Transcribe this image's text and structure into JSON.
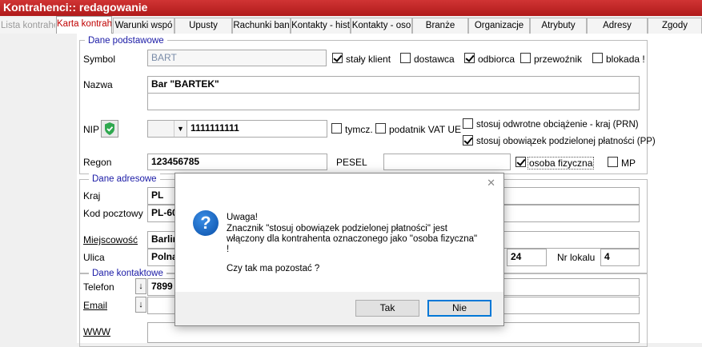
{
  "window": {
    "title": "Kontrahenci:: redagowanie"
  },
  "tabs": [
    {
      "label": "Lista kontrahe",
      "state": "disabled"
    },
    {
      "label": "Karta kontrahe",
      "state": "active"
    },
    {
      "label": "Warunki wspó",
      "state": "normal"
    },
    {
      "label": "Upusty",
      "state": "normal"
    },
    {
      "label": "Rachunki ban",
      "state": "normal"
    },
    {
      "label": "Kontakty - hist",
      "state": "normal"
    },
    {
      "label": "Kontakty - oso",
      "state": "normal"
    },
    {
      "label": "Branże",
      "state": "normal"
    },
    {
      "label": "Organizacje",
      "state": "normal"
    },
    {
      "label": "Atrybuty",
      "state": "normal"
    },
    {
      "label": "Adresy",
      "state": "normal"
    },
    {
      "label": "Zgody",
      "state": "normal"
    }
  ],
  "basic": {
    "group_title": "Dane podstawowe",
    "symbol_label": "Symbol",
    "symbol_value": "BART",
    "name_label": "Nazwa",
    "name_value": "Bar \"BARTEK\"",
    "name_value2": "",
    "nip_label": "NIP",
    "nip_value": "1111111111",
    "regon_label": "Regon",
    "regon_value": "123456785",
    "pesel_label": "PESEL",
    "pesel_value": "",
    "checkboxes": {
      "staly_klient": {
        "label": "stały klient",
        "checked": true
      },
      "dostawca": {
        "label": "dostawca",
        "checked": false
      },
      "odbiorca": {
        "label": "odbiorca",
        "checked": true
      },
      "przewoznik": {
        "label": "przewoźnik",
        "checked": false
      },
      "blokada": {
        "label": "blokada !",
        "checked": false
      },
      "tymcz": {
        "label": "tymcz.",
        "checked": false
      },
      "podatnik_vat_ue": {
        "label": "podatnik VAT UE",
        "checked": false
      },
      "prn": {
        "label": "stosuj odwrotne obciążenie - kraj (PRN)",
        "checked": false
      },
      "pp": {
        "label": "stosuj obowiązek podzielonej płatności (PP)",
        "checked": true
      },
      "osoba_fizyczna": {
        "label": "osoba fizyczna",
        "checked": true
      },
      "mp": {
        "label": "MP",
        "checked": false
      }
    }
  },
  "address": {
    "group_title": "Dane adresowe",
    "kraj_label": "Kraj",
    "kraj_value": "PL",
    "kod_label": "Kod pocztowy",
    "kod_value": "PL-60",
    "miejscowosc_label": "Miejscowość",
    "miejscowosc_value": "Barlin",
    "ulica_label": "Ulica",
    "ulica_value": "Polna",
    "nr_domu_value": "24",
    "nr_lokalu_label": "Nr lokalu",
    "nr_lokalu_value": "4"
  },
  "contact": {
    "group_title": "Dane kontaktowe",
    "telefon_label": "Telefon",
    "telefon_value": "7899",
    "email_label": "Email",
    "www_label": "WWW"
  },
  "dialog": {
    "line1": "Uwaga!",
    "line2": "Znacznik \"stosuj obowiązek podzielonej płatności\" jest",
    "line3": "włączony dla kontrahenta oznaczonego jako \"osoba fizyczna\"",
    "line4": "!",
    "question": "Czy tak ma pozostać ?",
    "yes_label": "Tak",
    "no_label": "Nie",
    "close_glyph": "✕",
    "icon_glyph": "?"
  },
  "icons": {
    "shield": "shield-check-icon",
    "question": "question-icon",
    "arrow_down": "↓"
  },
  "colors": {
    "titlebar": "#c02020",
    "active_tab_text": "#c00000",
    "group_title": "#1a1aa6",
    "default_button_border": "#0078d7"
  }
}
